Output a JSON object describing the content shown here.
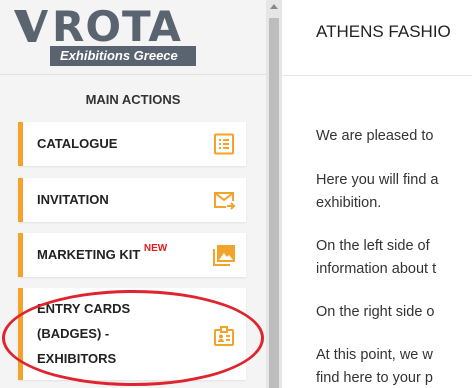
{
  "logo": {
    "word": "ROTA",
    "tagline": "Exhibitions Greece"
  },
  "sidebar": {
    "section_title": "MAIN ACTIONS",
    "items": [
      {
        "label": "CATALOGUE",
        "icon": "list-document-icon"
      },
      {
        "label": "INVITATION",
        "icon": "mail-forward-icon"
      },
      {
        "label": "MARKETING KIT",
        "badge": "NEW",
        "icon": "image-gallery-icon"
      },
      {
        "label_lines": [
          "ENTRY CARDS",
          "(BADGES) -",
          "EXHIBITORS"
        ],
        "icon": "id-badge-icon"
      }
    ]
  },
  "main": {
    "title": "ATHENS FASHIO",
    "paragraphs": [
      "We are pleased to",
      "Here you will find a",
      "exhibition.",
      "On the left side of",
      "information about t",
      "On the right side o",
      "At this point, we w",
      "find here to your p"
    ]
  },
  "colors": {
    "accent": "#f1a32b",
    "highlight": "#e0242f",
    "logo": "#5a6470"
  }
}
